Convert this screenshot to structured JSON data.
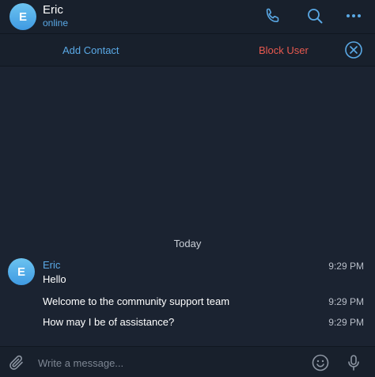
{
  "header": {
    "avatar_letter": "E",
    "name": "Eric",
    "status": "online",
    "icons": [
      "phone-icon",
      "search-icon",
      "more-icon"
    ]
  },
  "action_bar": {
    "add_contact": "Add Contact",
    "block_user": "Block User"
  },
  "chat": {
    "date_separator": "Today",
    "sender_avatar_letter": "E",
    "sender": "Eric",
    "messages": [
      {
        "text": "Hello",
        "time": "9:29 PM"
      },
      {
        "text": "Welcome to the community support team",
        "time": "9:29 PM"
      },
      {
        "text": "How may I be of assistance?",
        "time": "9:29 PM"
      }
    ]
  },
  "composer": {
    "placeholder": "Write a message...",
    "value": ""
  },
  "colors": {
    "accent": "#5aa9e6",
    "danger": "#e8594f",
    "background": "#18202c"
  }
}
